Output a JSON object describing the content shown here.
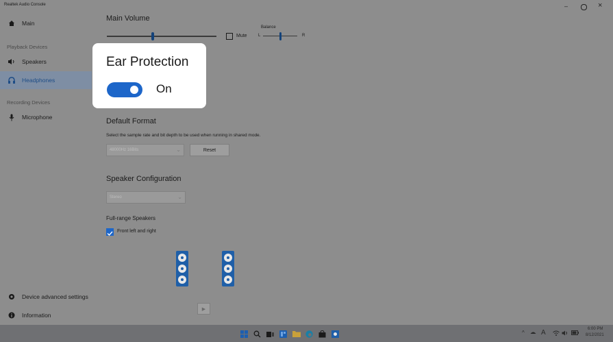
{
  "window": {
    "title": "Realtek Audio Console",
    "controls": {
      "minimize": "–",
      "maximize": "⚲",
      "close": "×"
    }
  },
  "sidebar": {
    "main_label": "Main",
    "playback_header": "Playback Devices",
    "items": [
      {
        "label": "Speakers",
        "icon": "speaker-icon"
      },
      {
        "label": "Headphones",
        "icon": "headphones-icon",
        "active": true
      }
    ],
    "recording_header": "Recording Devices",
    "recording_items": [
      {
        "label": "Microphone",
        "icon": "microphone-icon"
      }
    ],
    "footer": [
      {
        "label": "Device advanced settings",
        "icon": "gear-icon"
      },
      {
        "label": "Information",
        "icon": "info-icon"
      }
    ]
  },
  "main_volume": {
    "title": "Main Volume",
    "level": 0.42,
    "mute_label": "Mute",
    "balance_label": "Balance",
    "balance_left": "L",
    "balance_right": "R",
    "balance": 0.5
  },
  "ear_protection": {
    "title": "Ear Protection",
    "state_label": "On",
    "on": true
  },
  "default_format": {
    "title": "Default Format",
    "description": "Select the sample rate and bit depth to be used when running in shared mode.",
    "selected": "48000Hz 16Bits",
    "reset_label": "Reset"
  },
  "speaker_configuration": {
    "title": "Speaker Configuration",
    "selected": "Stereo"
  },
  "full_range": {
    "title": "Full-range Speakers",
    "checkbox_label": "Front left and right",
    "checked": true
  },
  "play_test": "▶",
  "taskbar": {
    "icons": [
      "windows-start-icon",
      "search-icon",
      "task-view-icon",
      "widgets-icon",
      "file-explorer-icon",
      "edge-icon",
      "store-icon",
      "realtek-icon"
    ],
    "tray": {
      "chevron": "^",
      "lang": "A",
      "time": "6:00 PM",
      "date": "8/12/2021"
    }
  },
  "colors": {
    "accent": "#1d66c9",
    "speaker_blue": "#1f5fa8",
    "active_bg": "#7e8ea4"
  }
}
